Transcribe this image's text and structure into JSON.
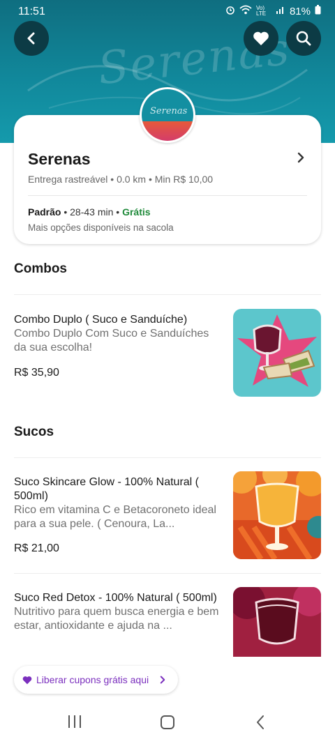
{
  "status_bar": {
    "time": "11:51",
    "battery": "81%",
    "network": "Vo) LTE"
  },
  "hero": {
    "background_text": "Serenas"
  },
  "store": {
    "name": "Serenas",
    "meta": "Entrega rastreável • 0.0 km • Min R$ 10,00",
    "delivery_mode": "Padrão",
    "delivery_time": " • 28-43 min • ",
    "delivery_fee": "Grátis",
    "more_options": "Mais opções disponíveis na sacola",
    "logo_text": "Serenas"
  },
  "sections": [
    {
      "title": "Combos",
      "items": [
        {
          "title": "Combo Duplo ( Suco e Sanduíche)",
          "description": "Combo Duplo Com Suco e Sanduíches da sua escolha!",
          "price": "R$ 35,90"
        }
      ]
    },
    {
      "title": "Sucos",
      "items": [
        {
          "title": "Suco Skincare Glow - 100% Natural ( 500ml)",
          "description": "Rico em vitamina C e Betacoroneto ideal para a sua pele. ( Cenoura, La...",
          "price": "R$ 21,00"
        },
        {
          "title": "Suco Red Detox - 100% Natural ( 500ml)",
          "description": "Nutritivo para quem busca energia e bem estar, antioxidante e ajuda na ...",
          "price": ""
        }
      ]
    }
  ],
  "coupon": {
    "label": "Liberar cupons grátis aqui"
  },
  "colors": {
    "accent": "#7b2fbe",
    "free": "#1f8a3a",
    "hero": "#11889b"
  }
}
